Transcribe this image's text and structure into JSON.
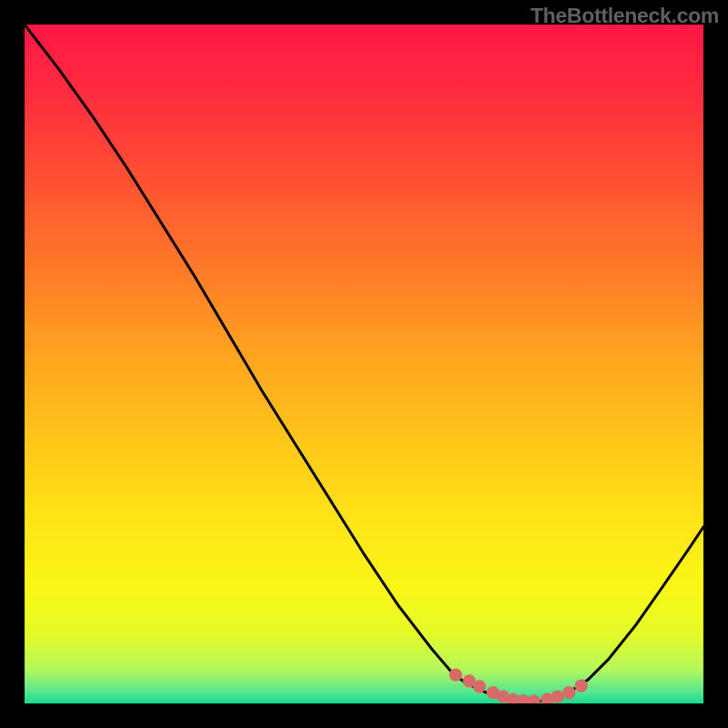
{
  "watermark": "TheBottleneck.com",
  "chart_data": {
    "type": "line",
    "title": "",
    "xlabel": "",
    "ylabel": "",
    "xlim": [
      0,
      100
    ],
    "ylim": [
      0,
      100
    ],
    "x": [
      0,
      5,
      10,
      15,
      20,
      25,
      30,
      35,
      40,
      45,
      50,
      55,
      60,
      63,
      65,
      68,
      70,
      72,
      74,
      76,
      78,
      80,
      83,
      86,
      90,
      94,
      98,
      100
    ],
    "y": [
      100,
      93.5,
      86.5,
      79,
      71,
      63,
      54.5,
      46,
      38,
      30,
      22,
      14.5,
      8,
      4.5,
      3,
      1.6,
      0.9,
      0.45,
      0.25,
      0.35,
      0.7,
      1.5,
      3.5,
      6.5,
      11.5,
      17.2,
      23,
      26
    ],
    "highlight_points": {
      "x": [
        63.5,
        65.5,
        67,
        69,
        70.5,
        72,
        73.5,
        75,
        77,
        78.5,
        80.2,
        82
      ],
      "y": [
        4.2,
        3.3,
        2.5,
        1.6,
        1.0,
        0.55,
        0.35,
        0.35,
        0.6,
        1.0,
        1.6,
        2.6
      ]
    },
    "gradient_stops": [
      {
        "offset": 0.0,
        "color": "#ff1744"
      },
      {
        "offset": 0.1,
        "color": "#ff2b3f"
      },
      {
        "offset": 0.22,
        "color": "#ff4e33"
      },
      {
        "offset": 0.36,
        "color": "#ff7a28"
      },
      {
        "offset": 0.5,
        "color": "#ffa71f"
      },
      {
        "offset": 0.62,
        "color": "#ffc81a"
      },
      {
        "offset": 0.74,
        "color": "#ffe617"
      },
      {
        "offset": 0.83,
        "color": "#f9f716"
      },
      {
        "offset": 0.9,
        "color": "#e3fb2a"
      },
      {
        "offset": 0.95,
        "color": "#b4f85b"
      },
      {
        "offset": 0.983,
        "color": "#57e78f"
      },
      {
        "offset": 1.0,
        "color": "#15db8f"
      }
    ],
    "highlight_color": "#d96a6a",
    "curve_color": "#000000"
  }
}
